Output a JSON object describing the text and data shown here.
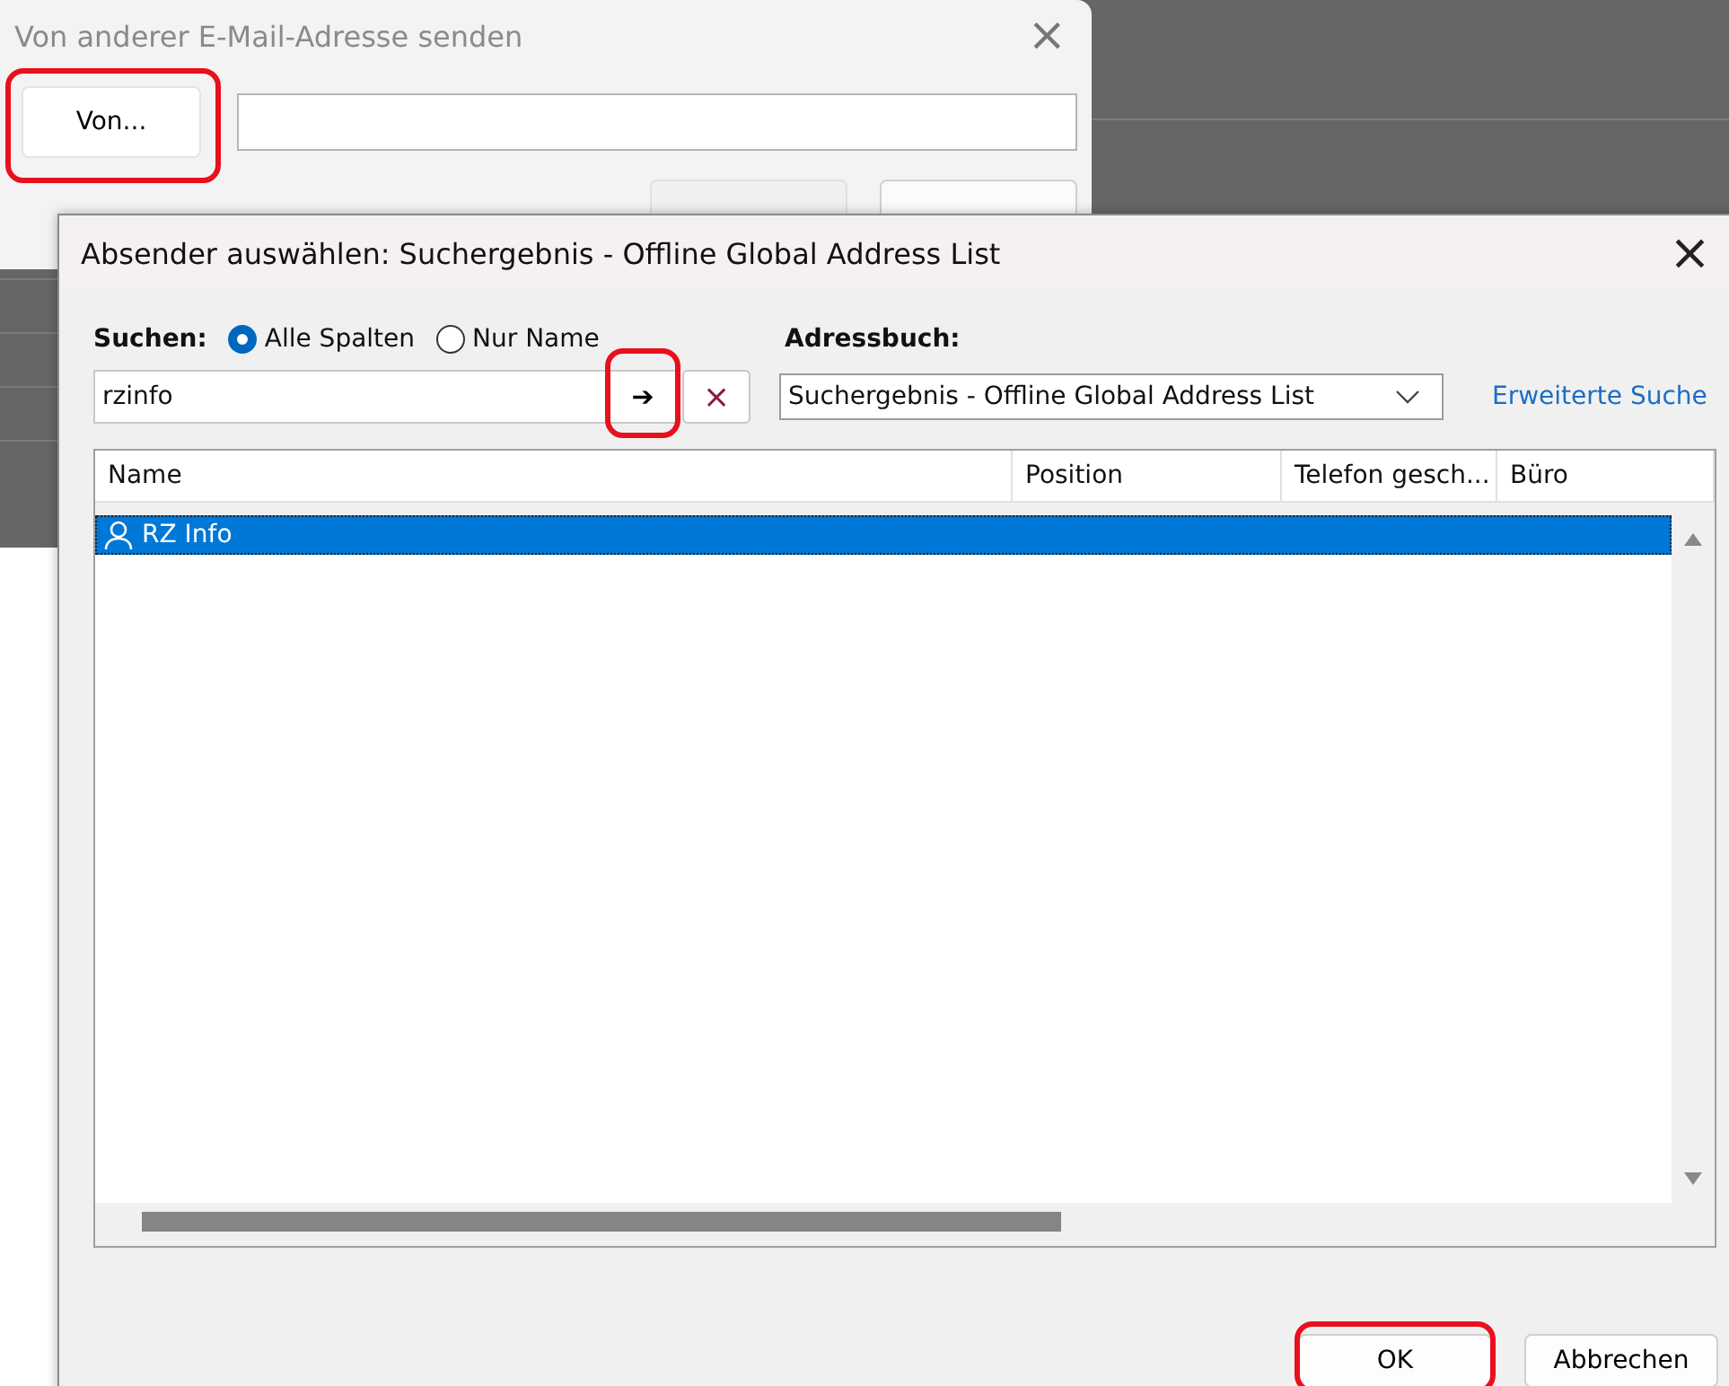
{
  "back_dialog": {
    "title": "Von anderer E-Mail-Adresse senden",
    "close": "×",
    "from_button": {
      "label": "Von...",
      "highlighted": true
    }
  },
  "dialog": {
    "title": "Absender auswählen: Suchergebnis - Offline Global Address List",
    "close": "×",
    "search_label": "Suchen:",
    "search_options": [
      {
        "label": "Alle Spalten",
        "selected": true
      },
      {
        "label": "Nur Name",
        "selected": false
      }
    ],
    "search_field": {
      "value": "rzinfo"
    },
    "go_button": {
      "label": "➔",
      "highlighted": true
    },
    "clear_button": {
      "label": "×"
    },
    "address_book_label": "Adressbuch:",
    "address_book": {
      "value": "Suchergebnis - Offline Global Address List"
    },
    "advanced_link": "Erweiterte Suche",
    "table": {
      "columns": [
        "Name",
        "Position",
        "Telefon gesch...",
        "Büro"
      ],
      "rows": [
        {
          "name": "RZ Info",
          "selected": true
        }
      ]
    },
    "buttons": [
      {
        "label": "OK",
        "highlighted": true
      },
      {
        "label": "Abbrechen",
        "highlighted": false
      }
    ]
  }
}
